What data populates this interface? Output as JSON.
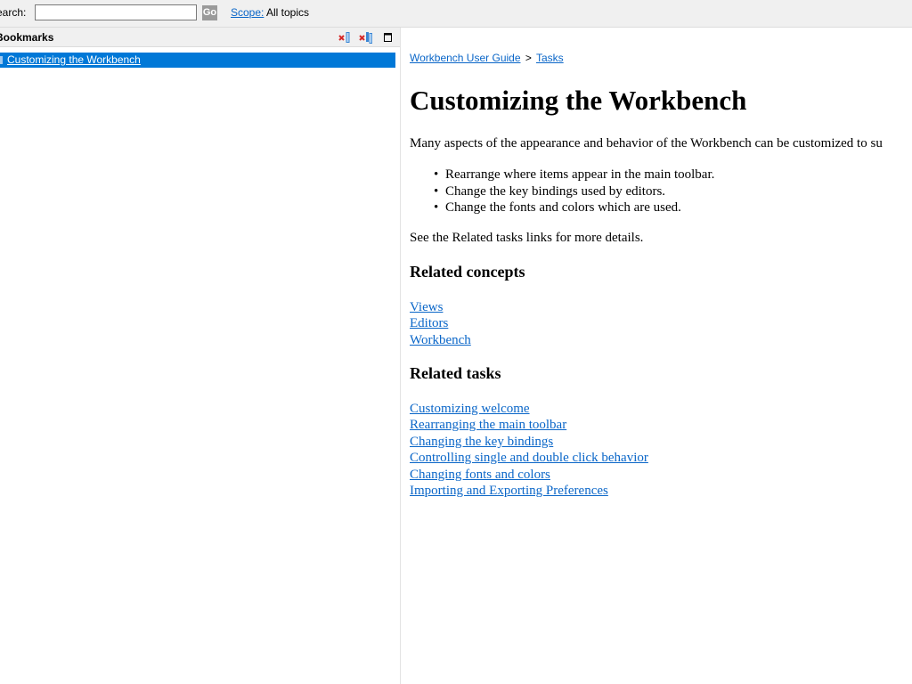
{
  "toolbar": {
    "search_label": "earch:",
    "search_value": "",
    "go_label": "Go",
    "scope_label": "Scope:",
    "scope_value": "All topics"
  },
  "bookmarks": {
    "title": "Bookmarks",
    "icons": [
      "remove-bookmark-icon",
      "remove-all-bookmarks-icon",
      "maximize-icon"
    ],
    "items": [
      {
        "label": "Customizing the Workbench",
        "selected": true
      }
    ]
  },
  "content": {
    "breadcrumb": {
      "items": [
        "Workbench User Guide",
        "Tasks"
      ],
      "separator": ">"
    },
    "title": "Customizing the Workbench",
    "intro": "Many aspects of the appearance and behavior of the Workbench can be customized to su",
    "bullets": [
      "Rearrange where items appear in the main toolbar.",
      "Change the key bindings used by editors.",
      "Change the fonts and colors which are used."
    ],
    "see_also": "See the Related tasks links for more details.",
    "related_concepts": {
      "heading": "Related concepts",
      "links": [
        "Views",
        "Editors",
        "Workbench"
      ]
    },
    "related_tasks": {
      "heading": "Related tasks",
      "links": [
        "Customizing welcome",
        "Rearranging the main toolbar",
        "Changing the key bindings",
        "Controlling single and double click behavior",
        "Changing fonts and colors",
        "Importing and Exporting Preferences"
      ]
    }
  },
  "colors": {
    "link": "#0a66c8",
    "selection": "#0078d7",
    "toolbar_bg": "#f0f0f0"
  }
}
